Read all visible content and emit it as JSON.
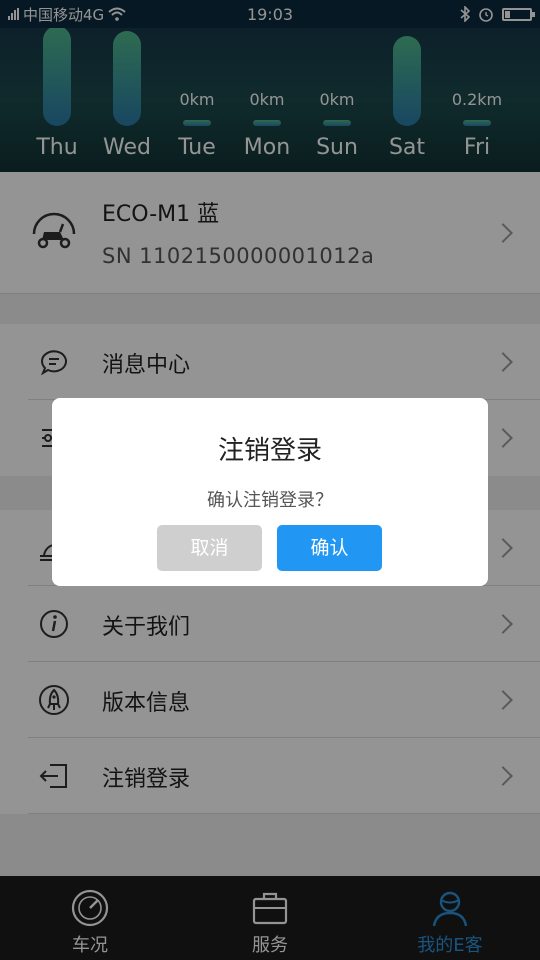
{
  "status_bar": {
    "carrier": "中国移动4G",
    "time": "19:03",
    "icons": [
      "signal-icon",
      "wifi-icon",
      "bluetooth-icon",
      "alarm-icon",
      "battery-icon"
    ]
  },
  "chart": {
    "unit": "km",
    "days": [
      {
        "label": "Thu",
        "value_label": "",
        "level": 1.0
      },
      {
        "label": "Wed",
        "value_label": "",
        "level": 0.95
      },
      {
        "label": "Tue",
        "value_label": "0km",
        "level": 0.0
      },
      {
        "label": "Mon",
        "value_label": "0km",
        "level": 0.0
      },
      {
        "label": "Sun",
        "value_label": "0km",
        "level": 0.0
      },
      {
        "label": "Sat",
        "value_label": "",
        "level": 0.9
      },
      {
        "label": "Fri",
        "value_label": "0.2km",
        "level": 0.05
      }
    ]
  },
  "device": {
    "name": "ECO-M1 蓝",
    "sn": "SN 1102150000001012a",
    "icon": "scooter-icon"
  },
  "menu": [
    {
      "label": "消息中心",
      "icon": "chat-bubble-icon"
    },
    {
      "label": "",
      "icon": "sliders-icon"
    },
    {
      "label": "",
      "icon": "speed-icon"
    },
    {
      "label": "关于我们",
      "icon": "info-icon"
    },
    {
      "label": "版本信息",
      "icon": "rocket-icon"
    },
    {
      "label": "注销登录",
      "icon": "logout-icon"
    }
  ],
  "nav": [
    {
      "label": "车况",
      "icon": "speedometer-icon",
      "active": false
    },
    {
      "label": "服务",
      "icon": "briefcase-icon",
      "active": false
    },
    {
      "label": "我的E客",
      "icon": "user-icon",
      "active": true
    }
  ],
  "dialog": {
    "title": "注销登录",
    "message": "确认注销登录？",
    "cancel": "取消",
    "confirm": "确认"
  },
  "colors": {
    "accent": "#2196f3",
    "nav_active": "#2b8fd9",
    "bar_top": "#4fb98c",
    "bar_bottom": "#2a7aa8"
  }
}
